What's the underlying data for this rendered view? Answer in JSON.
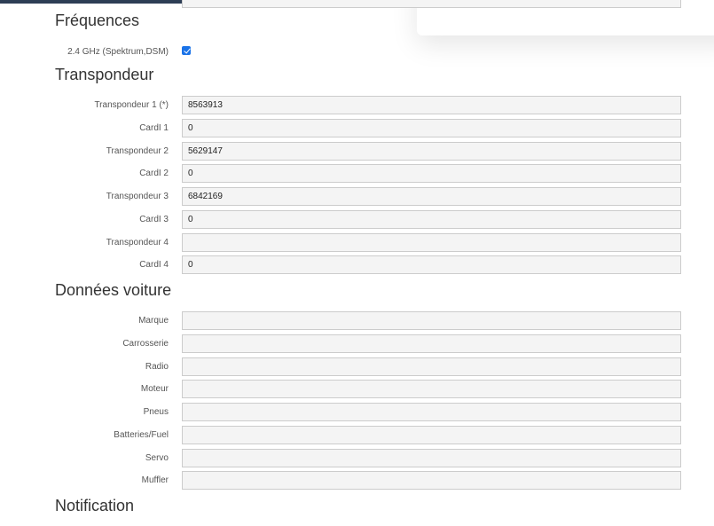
{
  "sections": {
    "frequences": {
      "title": "Fréquences",
      "freq_label": "2.4 GHz (Spektrum,DSM)",
      "freq_checked": true
    },
    "transpondeur": {
      "title": "Transpondeur",
      "rows": [
        {
          "label": "Transpondeur 1 (*)",
          "value": "8563913"
        },
        {
          "label": "CardI 1",
          "value": "0"
        },
        {
          "label": "Transpondeur 2",
          "value": "5629147"
        },
        {
          "label": "CardI 2",
          "value": "0"
        },
        {
          "label": "Transpondeur 3",
          "value": "6842169"
        },
        {
          "label": "CardI 3",
          "value": "0"
        },
        {
          "label": "Transpondeur 4",
          "value": ""
        },
        {
          "label": "CardI 4",
          "value": "0"
        }
      ]
    },
    "voiture": {
      "title": "Données voiture",
      "rows": [
        {
          "label": "Marque",
          "value": ""
        },
        {
          "label": "Carrosserie",
          "value": ""
        },
        {
          "label": "Radio",
          "value": ""
        },
        {
          "label": "Moteur",
          "value": ""
        },
        {
          "label": "Pneus",
          "value": ""
        },
        {
          "label": "Batteries/Fuel",
          "value": ""
        },
        {
          "label": "Servo",
          "value": ""
        },
        {
          "label": "Muffler",
          "value": ""
        }
      ]
    },
    "notification": {
      "title": "Notification"
    }
  },
  "colors": {
    "topbar": "#2d3e55",
    "checkbox": "#1a73e8",
    "field_bg": "#f4f4f4",
    "field_border": "#cccccc"
  }
}
